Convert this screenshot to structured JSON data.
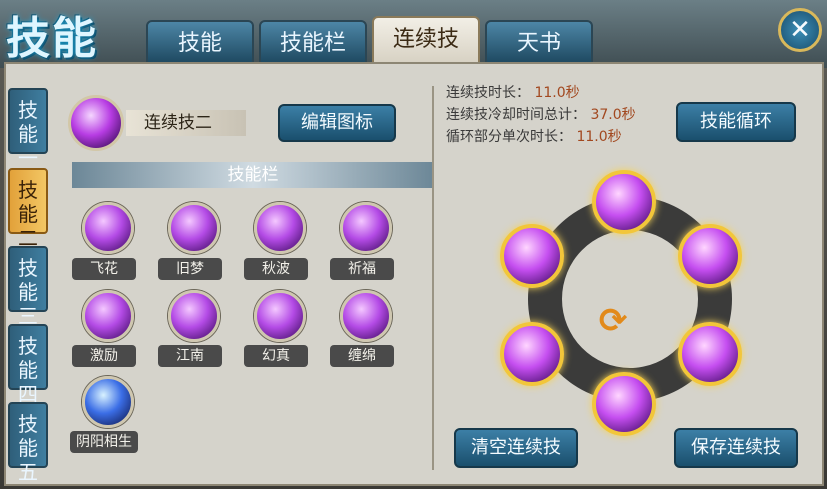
{
  "header": {
    "logo": "技能",
    "tabs": [
      {
        "label": "技能"
      },
      {
        "label": "技能栏"
      },
      {
        "label": "连续技"
      },
      {
        "label": "天书"
      }
    ],
    "close_icon": "close-icon"
  },
  "sidebar": {
    "items": [
      {
        "label": "技能一"
      },
      {
        "label": "技能二"
      },
      {
        "label": "技能三"
      },
      {
        "label": "技能四"
      },
      {
        "label": "技能五"
      }
    ]
  },
  "combo": {
    "name": "连续技二",
    "edit_label": "编辑图标",
    "bar_title": "技能栏"
  },
  "skills": [
    {
      "label": "飞花"
    },
    {
      "label": "旧梦"
    },
    {
      "label": "秋波"
    },
    {
      "label": "祈福"
    },
    {
      "label": "激励"
    },
    {
      "label": "江南"
    },
    {
      "label": "幻真"
    },
    {
      "label": "缠绵"
    },
    {
      "label": "阴阳相生"
    }
  ],
  "info": {
    "duration_label": "连续技时长：",
    "duration_value": "11.0秒",
    "cooldown_label": "连续技冷却时间总计：",
    "cooldown_value": "37.0秒",
    "cycle_label": "循环部分单次时长：",
    "cycle_value": "11.0秒"
  },
  "buttons": {
    "cycle": "技能循环",
    "clear": "清空连续技",
    "save": "保存连续技"
  },
  "colors": {
    "accent_gold": "#f2c63a",
    "tab_blue": "#2f6f93",
    "panel_bg": "#d5d3cb"
  }
}
